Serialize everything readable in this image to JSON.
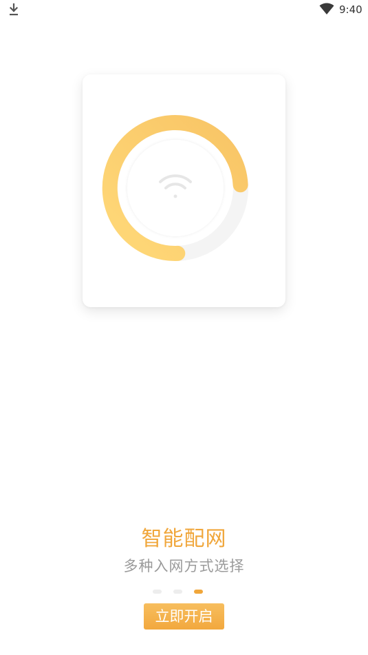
{
  "status_bar": {
    "time": "9:40",
    "left_icon": "download-icon",
    "right_icon": "wifi-icon"
  },
  "illustration": {
    "icon": "wifi-icon",
    "ring_progress": 0.75,
    "ring_color_start": "#FFD36E",
    "ring_color_end": "#F7C063",
    "track_color": "#F4F4F4"
  },
  "onboarding": {
    "title": "智能配网",
    "subtitle": "多种入网方式选择",
    "page_count": 3,
    "active_page": 3,
    "accent_color": "#F0A63A"
  },
  "start_button": {
    "label": "立即开启"
  }
}
